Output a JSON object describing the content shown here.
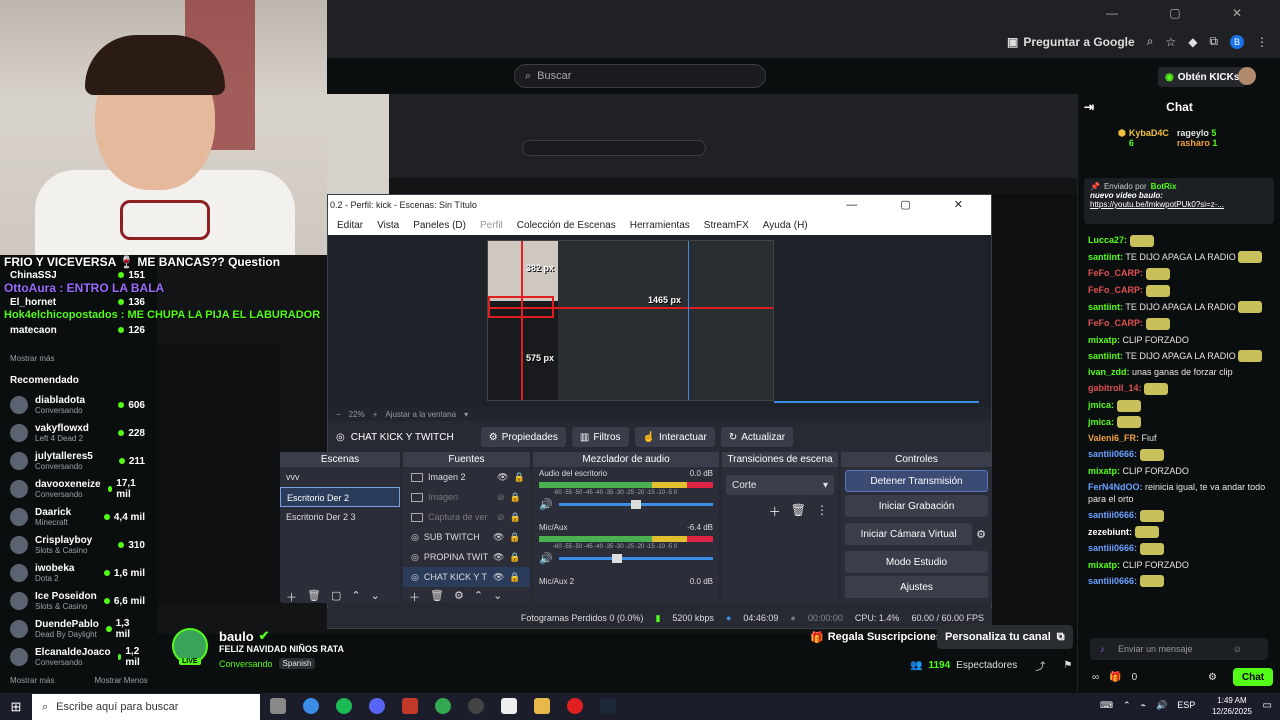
{
  "chrome": {
    "ask_google": "Preguntar a Google",
    "profile_letter": "B"
  },
  "kick": {
    "search_placeholder": "Buscar",
    "get_kicks": "Obtén KICKs"
  },
  "overlay": {
    "lines": [
      "FRIO Y VICEVERSA 🍷 ME BANCAS?? Question",
      "OttoAura : ENTRO LA BALA",
      "Hok4elchicopostados : ME CHUPA LA PIJA EL LABURADOR"
    ]
  },
  "sidebar": {
    "top_items": [
      {
        "name": "ChinaSSJ",
        "count": "151"
      },
      {
        "name": "El_hornet",
        "count": "136"
      },
      {
        "name": "matecaon",
        "count": "126"
      }
    ],
    "show_more": "Mostrar más",
    "recommended_title": "Recomendado",
    "recommended": [
      {
        "name": "diabladota",
        "sub": "Conversando",
        "count": "606"
      },
      {
        "name": "vakyflowxd",
        "sub": "Left 4 Dead 2",
        "count": "228"
      },
      {
        "name": "julytalleres5",
        "sub": "Conversando",
        "count": "211"
      },
      {
        "name": "davooxeneize",
        "sub": "Conversando",
        "count": "17,1 mil"
      },
      {
        "name": "Daarick",
        "sub": "Minecraft",
        "count": "4,4 mil"
      },
      {
        "name": "Crisplayboy",
        "sub": "Slots & Casino",
        "count": "310"
      },
      {
        "name": "iwobeka",
        "sub": "Dota 2",
        "count": "1,6 mil"
      },
      {
        "name": "Ice Poseidon",
        "sub": "Slots & Casino",
        "count": "6,6 mil"
      },
      {
        "name": "DuendePablo",
        "sub": "Dead By Daylight",
        "count": "1,3 mil"
      },
      {
        "name": "ElcanaldeJoaco",
        "sub": "Conversando",
        "count": "1,2 mil"
      }
    ],
    "show_more_bottom": "Mostrar más",
    "show_less": "Mostrar Menos"
  },
  "obs": {
    "title": "0.2 - Perfil: kick - Escenas: Sin Título",
    "menu": [
      "Editar",
      "Vista",
      "Paneles (D)",
      "Perfil",
      "Colección de Escenas",
      "Herramientas",
      "StreamFX",
      "Ayuda (H)"
    ],
    "preview_labels": {
      "a": "382 px",
      "b": "1465 px",
      "c": "575 px"
    },
    "zoom": "22%",
    "fit": "Ajustar a la ventana",
    "source_name": "CHAT KICK Y TWITCH",
    "btn_props": "Propiedades",
    "btn_filters": "Filtros",
    "btn_interact": "Interactuar",
    "btn_refresh": "Actualizar",
    "docks": {
      "scenes": "Escenas",
      "sources": "Fuentes",
      "mixer": "Mezclador de audio",
      "transitions": "Transiciones de escena",
      "controls": "Controles"
    },
    "scenes": [
      "vvv",
      "Escritorio Der 2",
      "Escritorio Der 2 3"
    ],
    "sources": [
      {
        "name": "Imagen 2",
        "enabled": true
      },
      {
        "name": "Imagen",
        "enabled": false
      },
      {
        "name": "Captura de ver",
        "enabled": false
      },
      {
        "name": "SUB TWITCH",
        "enabled": true
      },
      {
        "name": "PROPINA TWIT",
        "enabled": true
      },
      {
        "name": "CHAT KICK Y T",
        "enabled": true
      }
    ],
    "mixer": [
      {
        "name": "Audio del escritorio",
        "db": "0.0 dB",
        "level": 0.5
      },
      {
        "name": "Mic/Aux",
        "db": "-6.4 dB",
        "level": 0.38
      },
      {
        "name": "Mic/Aux 2",
        "db": "0.0 dB",
        "level": 0
      }
    ],
    "meter_ticks": "-60 -55 -50 -45 -40 -35 -30 -25 -20 -15 -10 -5 0",
    "transition": "Corte",
    "controls": [
      "Detener Transmisión",
      "Iniciar Grabación",
      "Iniciar Cámara Virtual",
      "Modo Estudio",
      "Ajustes"
    ],
    "status": {
      "dropped": "Fotogramas Perdidos 0 (0.0%)",
      "kbps": "5200 kbps",
      "live_time": "04:46:09",
      "rec_time": "00:00:00",
      "cpu": "CPU: 1.4%",
      "fps": "60.00 / 60.00 FPS"
    }
  },
  "stream": {
    "streamer": "baulo",
    "live": "LIVE",
    "title": "FELIZ NAVIDAD NIÑOS RATA",
    "category": "Conversando",
    "language": "Spanish",
    "viewers": "1194",
    "viewers_label": "Espectadores"
  },
  "actions": {
    "gift_subs": "Regala Suscripciones",
    "customize": "Personaliza tu canal"
  },
  "chat": {
    "title": "Chat",
    "top_gifter": {
      "name": "KybaD4C",
      "count": "6"
    },
    "gifters": [
      {
        "name": "rageylo",
        "count": "5"
      },
      {
        "name": "rasharo",
        "count": "1"
      }
    ],
    "pinned_by": "Enviado por",
    "pinned_bot": "BotRix",
    "pinned_text": "nuevo video baulo:",
    "pinned_link": "https://youtu.be/lmkwpotPUk0?si=z-...",
    "messages": [
      {
        "user": "Lucca27:",
        "text": "",
        "emote": true
      },
      {
        "user": "santiint:",
        "text": "TE DIJO APAGA LA RADIO",
        "emote": true
      },
      {
        "user": "FeFo_CARP:",
        "text": "",
        "emote": true
      },
      {
        "user": "FeFo_CARP:",
        "text": "",
        "emote": true
      },
      {
        "user": "santiint:",
        "text": "TE DIJO APAGA LA RADIO",
        "emote": true
      },
      {
        "user": "FeFo_CARP:",
        "text": "",
        "emote": true
      },
      {
        "user": "mixatp:",
        "text": "CLIP FORZADO",
        "emote": false
      },
      {
        "user": "santiint:",
        "text": "TE DIJO APAGA LA RADIO",
        "emote": true
      },
      {
        "user": "ivan_zdd:",
        "text": "unas ganas de forzar clip",
        "emote": false
      },
      {
        "user": "gabitroll_14:",
        "text": "",
        "emote": true
      },
      {
        "user": "jmica:",
        "text": "",
        "emote": true
      },
      {
        "user": "jmica:",
        "text": "",
        "emote": true
      },
      {
        "user": "Valeni6_FR:",
        "text": "Fiuf",
        "emote": false
      },
      {
        "user": "santiii0666:",
        "text": "",
        "emote": true
      },
      {
        "user": "mixatp:",
        "text": "CLIP FORZADO",
        "emote": false
      },
      {
        "user": "FerN4NdOO:",
        "text": "reinicia igual, te va andar todo para el orto",
        "emote": false
      },
      {
        "user": "santiii0666:",
        "text": "",
        "emote": true
      },
      {
        "user": "zezebiunt:",
        "text": "",
        "emote": true
      },
      {
        "user": "santiii0666:",
        "text": "",
        "emote": true
      },
      {
        "user": "mixatp:",
        "text": "CLIP FORZADO",
        "emote": false
      },
      {
        "user": "santiii0666:",
        "text": "",
        "emote": true
      }
    ],
    "input_placeholder": "Enviar un mensaje",
    "kicks_count": "0",
    "send": "Chat"
  },
  "taskbar": {
    "search_placeholder": "Escribe aquí para buscar",
    "lang": "ESP",
    "time": "1:49 AM",
    "date": "12/26/2025"
  }
}
